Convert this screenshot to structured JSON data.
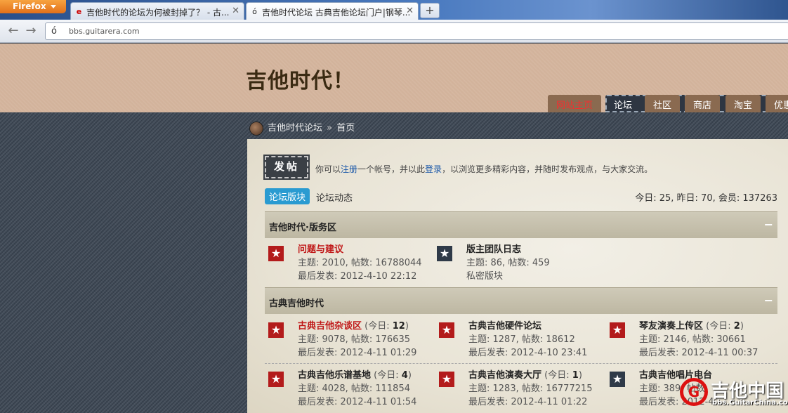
{
  "browser": {
    "menu_label": "Firefox",
    "tabs": [
      {
        "title": "吉他时代的论坛为何被封掉了？ - 古...",
        "favicon": "e"
      },
      {
        "title": "吉他时代论坛 古典吉他论坛门户|钢琴...",
        "favicon": "ó"
      }
    ],
    "new_tab_label": "+",
    "url": "bbs.guitarera.com"
  },
  "site": {
    "title": "吉他时代！",
    "nav": [
      "网站主页",
      "论坛",
      "社区",
      "商店",
      "淘宝",
      "优惠"
    ]
  },
  "breadcrumb": {
    "root": "吉他时代论坛",
    "separator": "»",
    "current": "首页"
  },
  "actions": {
    "post_button": "发帖"
  },
  "welcome": {
    "prefix": "你可以",
    "register": "注册",
    "mid": "一个帐号，并以此",
    "login": "登录",
    "suffix": "，以浏览更多精彩内容，并随时发布观点，与大家交流。"
  },
  "tabs": {
    "forum_blocks": "论坛版块",
    "forum_activity": "论坛动态"
  },
  "stats": "今日: 25, 昨日: 70, 会员: 137263",
  "sections": [
    {
      "title": "吉他时代·版务区",
      "forums": [
        {
          "name": "问题与建议",
          "stats": "主题: 2010, 帖数: 16788044",
          "last": "最后发表: 2012-4-10 22:12"
        },
        {
          "name": "版主团队日志",
          "stats": "主题: 86, 帖数: 459",
          "last": "私密版块"
        }
      ]
    },
    {
      "title": "古典吉他时代",
      "forums": [
        {
          "name": "古典吉他杂谈区",
          "today_label": "今日:",
          "today": "12",
          "stats": "主题: 9078, 帖数: 176635",
          "last": "最后发表: 2012-4-11 01:29"
        },
        {
          "name": "古典吉他硬件论坛",
          "stats": "主题: 1287, 帖数: 18612",
          "last": "最后发表: 2012-4-10 23:41"
        },
        {
          "name": "琴友演奏上传区",
          "today_label": "今日:",
          "today": "2",
          "stats": "主题: 2146, 帖数: 30661",
          "last": "最后发表: 2012-4-11 00:37"
        },
        {
          "name": "古典吉他乐谱基地",
          "today_label": "今日:",
          "today": "4",
          "stats": "主题: 4028, 帖数: 111854",
          "last": "最后发表: 2012-4-11 01:54"
        },
        {
          "name": "古典吉他演奏大厅",
          "today_label": "今日:",
          "today": "1",
          "stats": "主题: 1283, 帖数: 16777215",
          "last": "最后发表: 2012-4-11 01:22"
        },
        {
          "name": "古典吉他唱片电台",
          "stats": "主题: 389, 帖数:",
          "last": "最后发表: 2012-4"
        }
      ]
    }
  ],
  "watermark": {
    "logo_letter": "G",
    "name": "吉他中国",
    "url": "bbs.GuitarChina.com"
  }
}
